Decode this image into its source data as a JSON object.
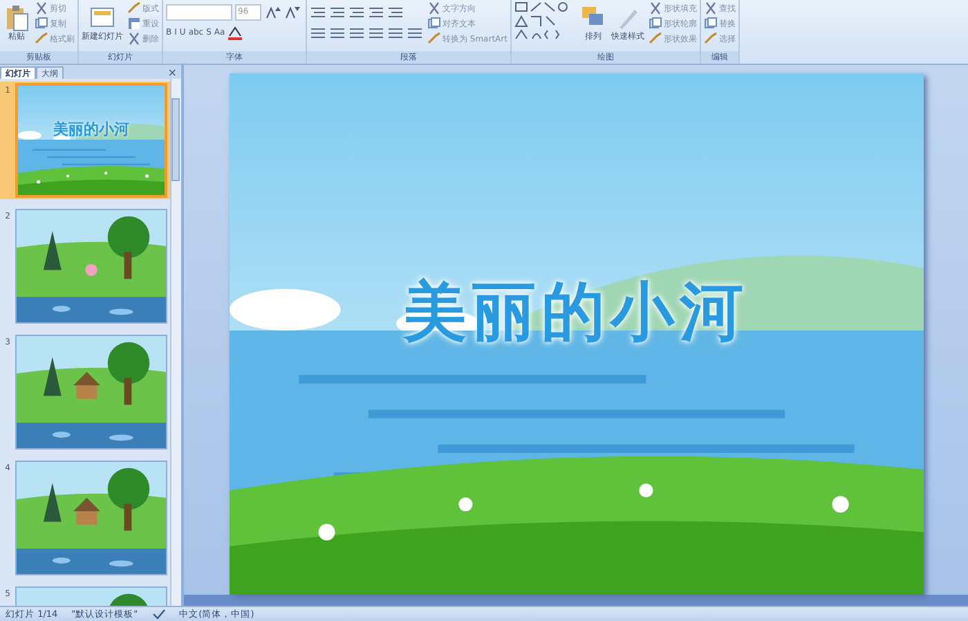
{
  "ribbon": {
    "groups": [
      {
        "kind": "clipboard",
        "label": "剪贴板",
        "big": "粘贴",
        "small": [
          "剪切",
          "复制",
          "格式刷"
        ]
      },
      {
        "kind": "slides",
        "label": "幻灯片",
        "big": "新建幻灯片",
        "small": [
          "版式",
          "重设",
          "删除"
        ]
      },
      {
        "kind": "font",
        "label": "字体",
        "font_size": "96",
        "buttons": [
          "B",
          "I",
          "U",
          "abc",
          "S",
          "Aa"
        ]
      },
      {
        "kind": "paragraph",
        "label": "段落",
        "small": [
          "文字方向",
          "对齐文本",
          "转换为 SmartArt"
        ]
      },
      {
        "kind": "drawing",
        "label": "绘图",
        "big": "排列",
        "quick": "快速样式",
        "small": [
          "形状填充",
          "形状轮廓",
          "形状效果"
        ]
      },
      {
        "kind": "editing",
        "label": "编辑",
        "small": [
          "查找",
          "替换",
          "选择"
        ]
      }
    ]
  },
  "panel": {
    "tabs": [
      {
        "label": "幻灯片",
        "selected": true
      },
      {
        "label": "大纲",
        "selected": false
      }
    ],
    "close": "×",
    "slides": [
      {
        "number": "1",
        "selected": true,
        "title": "美丽的小河"
      },
      {
        "number": "2",
        "selected": false
      },
      {
        "number": "3",
        "selected": false
      },
      {
        "number": "4",
        "selected": false
      },
      {
        "number": "5",
        "selected": false
      }
    ]
  },
  "slide": {
    "title": "美丽的小河"
  },
  "status_bar": [
    "幻灯片 1/14",
    "\"默认设计模板\"",
    "中文(简体，中国)"
  ]
}
